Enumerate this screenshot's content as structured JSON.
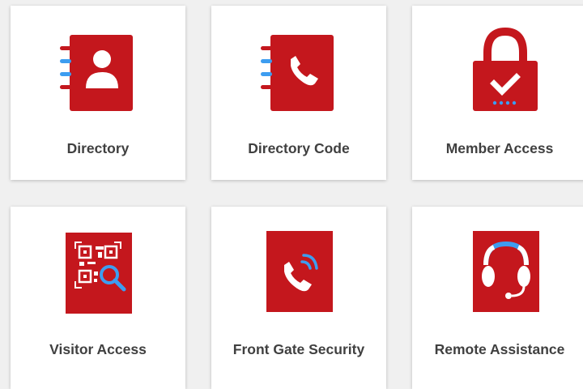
{
  "colors": {
    "accent_red": "#c4171d",
    "accent_blue": "#3d9df0",
    "label_text": "#404040",
    "page_background": "#f0f0f0"
  },
  "tiles": [
    {
      "label": "Directory",
      "icon": "address-book-person-icon"
    },
    {
      "label": "Directory Code",
      "icon": "address-book-phone-icon"
    },
    {
      "label": "Member Access",
      "icon": "padlock-check-icon"
    },
    {
      "label": "Visitor Access",
      "icon": "qr-code-search-icon"
    },
    {
      "label": "Front Gate Security",
      "icon": "phone-ringing-icon"
    },
    {
      "label": "Remote Assistance",
      "icon": "headset-icon"
    }
  ]
}
